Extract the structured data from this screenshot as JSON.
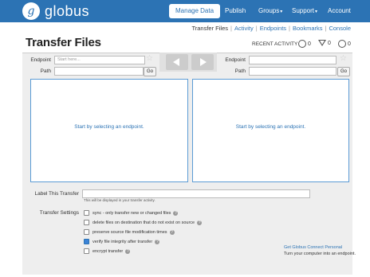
{
  "brand": {
    "name": "globus",
    "logo_letter": "g"
  },
  "nav": {
    "items": [
      {
        "label": "Manage Data",
        "active": true
      },
      {
        "label": "Publish"
      },
      {
        "label": "Groups",
        "caret": "▾"
      },
      {
        "label": "Support",
        "caret": "▾"
      },
      {
        "label": "Account"
      }
    ]
  },
  "subnav": [
    "Transfer Files",
    "Activity",
    "Endpoints",
    "Bookmarks",
    "Console"
  ],
  "page_title": "Transfer Files",
  "recent_activity": {
    "label": "RECENT ACTIVITY",
    "active": "0",
    "failed": "0",
    "done": "0"
  },
  "left": {
    "endpoint_label": "Endpoint",
    "endpoint_placeholder": "Start here...",
    "path_label": "Path",
    "go": "Go",
    "message": "Start by selecting an endpoint."
  },
  "right": {
    "endpoint_label": "Endpoint",
    "endpoint_placeholder": "",
    "path_label": "Path",
    "go": "Go",
    "message": "Start by selecting an endpoint."
  },
  "label_transfer": {
    "label": "Label This Transfer",
    "hint": "This will be displayed in your transfer activity."
  },
  "settings": {
    "label": "Transfer Settings",
    "options": [
      {
        "label": "sync - only transfer new or changed files",
        "checked": false
      },
      {
        "label": "delete files on destination that do not exist on source",
        "checked": false
      },
      {
        "label": "preserve source file modification times",
        "checked": false
      },
      {
        "label": "verify file integrity after transfer",
        "checked": true
      },
      {
        "label": "encrypt transfer",
        "checked": false
      }
    ]
  },
  "gcp": {
    "link": "Get Globus Connect Personal",
    "sub": "Turn your computer into an endpoint."
  },
  "colors": {
    "brand": "#2c73b4",
    "panel": "#eeeeee",
    "link": "#2c73b4"
  },
  "icons": [
    "star-icon",
    "arrow-left-icon",
    "arrow-right-icon",
    "help-icon",
    "circle-icon",
    "triangle-icon"
  ]
}
